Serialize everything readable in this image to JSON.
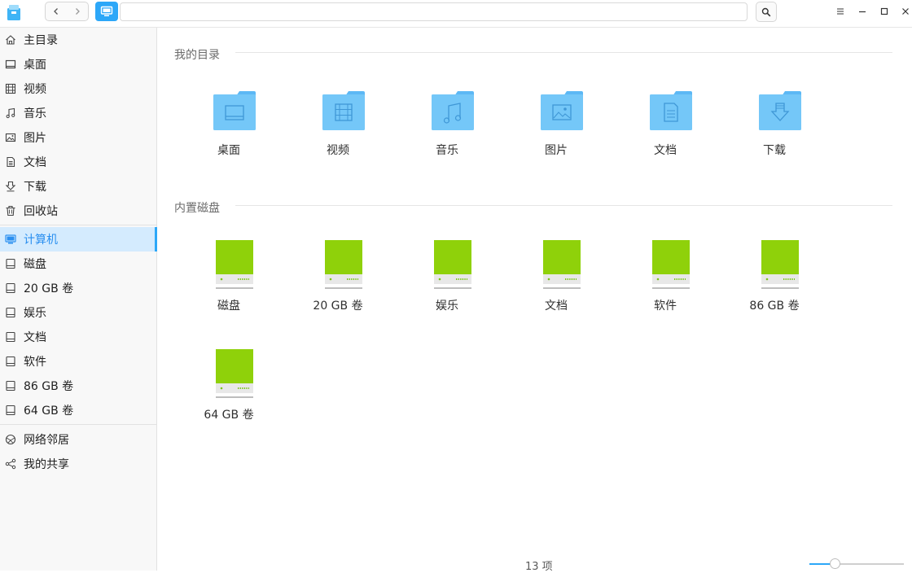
{
  "address": {
    "value": ""
  },
  "sidebar": {
    "items": [
      {
        "label": "主目录",
        "icon": "home-icon"
      },
      {
        "label": "桌面",
        "icon": "desktop-icon"
      },
      {
        "label": "视频",
        "icon": "video-icon"
      },
      {
        "label": "音乐",
        "icon": "music-icon"
      },
      {
        "label": "图片",
        "icon": "picture-icon"
      },
      {
        "label": "文档",
        "icon": "document-icon"
      },
      {
        "label": "下载",
        "icon": "download-icon"
      },
      {
        "label": "回收站",
        "icon": "trash-icon"
      },
      {
        "label": "计算机",
        "icon": "computer-icon",
        "active": true
      },
      {
        "label": "磁盘",
        "icon": "drive-icon"
      },
      {
        "label": "20 GB 卷",
        "icon": "drive-icon"
      },
      {
        "label": "娱乐",
        "icon": "drive-icon"
      },
      {
        "label": "文档",
        "icon": "drive-icon"
      },
      {
        "label": "软件",
        "icon": "drive-icon"
      },
      {
        "label": "86 GB 卷",
        "icon": "drive-icon"
      },
      {
        "label": "64 GB 卷",
        "icon": "drive-icon"
      },
      {
        "label": "网络邻居",
        "icon": "network-icon"
      },
      {
        "label": "我的共享",
        "icon": "share-icon"
      }
    ]
  },
  "main": {
    "my_dirs_title": "我的目录",
    "disks_title": "内置磁盘",
    "folders": [
      {
        "label": "桌面",
        "icon": "desktop-folder-icon"
      },
      {
        "label": "视频",
        "icon": "video-folder-icon"
      },
      {
        "label": "音乐",
        "icon": "music-folder-icon"
      },
      {
        "label": "图片",
        "icon": "picture-folder-icon"
      },
      {
        "label": "文档",
        "icon": "document-folder-icon"
      },
      {
        "label": "下载",
        "icon": "download-folder-icon"
      }
    ],
    "disks": [
      {
        "label": "磁盘"
      },
      {
        "label": "20 GB 卷"
      },
      {
        "label": "娱乐"
      },
      {
        "label": "文档"
      },
      {
        "label": "软件"
      },
      {
        "label": "86 GB 卷"
      },
      {
        "label": "64 GB 卷"
      }
    ]
  },
  "status": {
    "item_count": "13 项"
  },
  "zoom": {
    "level": 0.27
  },
  "colors": {
    "accent": "#2ca7f8",
    "folder": "#74c7f8",
    "disk": "#8fd10a"
  }
}
